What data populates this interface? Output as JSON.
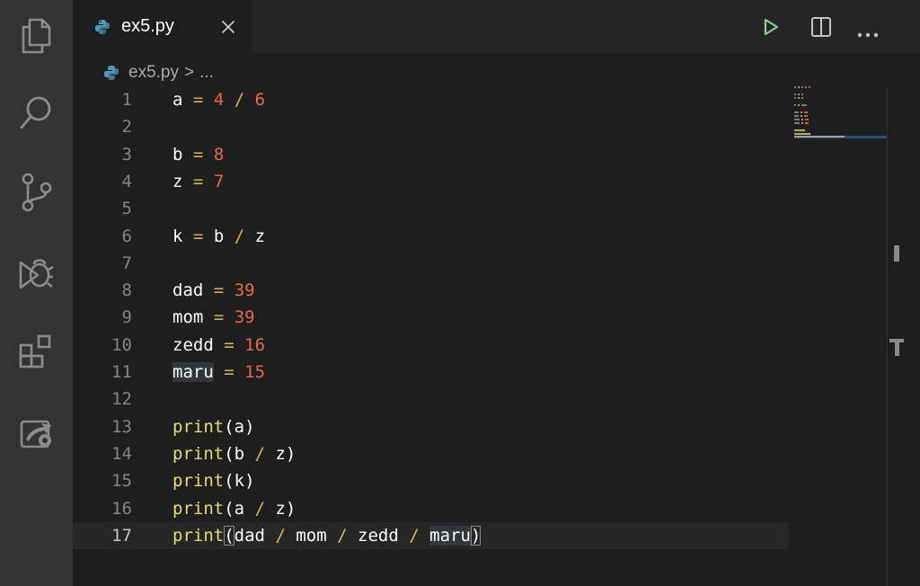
{
  "tab": {
    "title": "ex5.py"
  },
  "breadcrumb": {
    "file": "ex5.py",
    "separator": ">",
    "more": "..."
  },
  "activity_bar": {
    "items": [
      {
        "name": "explorer-icon"
      },
      {
        "name": "search-icon"
      },
      {
        "name": "source-control-icon"
      },
      {
        "name": "run-debug-icon"
      },
      {
        "name": "extensions-icon"
      },
      {
        "name": "remote-explorer-icon"
      }
    ]
  },
  "toolbar": {
    "run_icon": "play-icon",
    "split_icon": "split-editor-icon",
    "more_icon": "more-actions-icon"
  },
  "colors": {
    "variable": "#ffffff",
    "operator": "#d8b35b",
    "number": "#e06c4c",
    "function": "#e7db74",
    "line_number": "#858585",
    "run_icon": "#89d185",
    "python_icon": "#519aba"
  },
  "code": {
    "current_line": 17,
    "lines": [
      {
        "num": "1",
        "tokens": [
          [
            "var",
            "a"
          ],
          [
            "sp",
            " "
          ],
          [
            "op",
            "="
          ],
          [
            "sp",
            " "
          ],
          [
            "num",
            "4"
          ],
          [
            "sp",
            " "
          ],
          [
            "op",
            "/"
          ],
          [
            "sp",
            " "
          ],
          [
            "num",
            "6"
          ]
        ]
      },
      {
        "num": "2",
        "tokens": []
      },
      {
        "num": "3",
        "tokens": [
          [
            "var",
            "b"
          ],
          [
            "sp",
            " "
          ],
          [
            "op",
            "="
          ],
          [
            "sp",
            " "
          ],
          [
            "num",
            "8"
          ]
        ]
      },
      {
        "num": "4",
        "tokens": [
          [
            "var",
            "z"
          ],
          [
            "sp",
            " "
          ],
          [
            "op",
            "="
          ],
          [
            "sp",
            " "
          ],
          [
            "num",
            "7"
          ]
        ]
      },
      {
        "num": "5",
        "tokens": []
      },
      {
        "num": "6",
        "tokens": [
          [
            "var",
            "k"
          ],
          [
            "sp",
            " "
          ],
          [
            "op",
            "="
          ],
          [
            "sp",
            " "
          ],
          [
            "var",
            "b"
          ],
          [
            "sp",
            " "
          ],
          [
            "op",
            "/"
          ],
          [
            "sp",
            " "
          ],
          [
            "var",
            "z"
          ]
        ]
      },
      {
        "num": "7",
        "tokens": []
      },
      {
        "num": "8",
        "tokens": [
          [
            "var",
            "dad"
          ],
          [
            "sp",
            " "
          ],
          [
            "op",
            "="
          ],
          [
            "sp",
            " "
          ],
          [
            "num",
            "39"
          ]
        ]
      },
      {
        "num": "9",
        "tokens": [
          [
            "var",
            "mom"
          ],
          [
            "sp",
            " "
          ],
          [
            "op",
            "="
          ],
          [
            "sp",
            " "
          ],
          [
            "num",
            "39"
          ]
        ]
      },
      {
        "num": "10",
        "tokens": [
          [
            "var",
            "zedd"
          ],
          [
            "sp",
            " "
          ],
          [
            "op",
            "="
          ],
          [
            "sp",
            " "
          ],
          [
            "num",
            "16"
          ]
        ]
      },
      {
        "num": "11",
        "tokens": [
          [
            "hl",
            "maru"
          ],
          [
            "sp",
            " "
          ],
          [
            "op",
            "="
          ],
          [
            "sp",
            " "
          ],
          [
            "num",
            "15"
          ]
        ]
      },
      {
        "num": "12",
        "tokens": []
      },
      {
        "num": "13",
        "tokens": [
          [
            "fn",
            "print"
          ],
          [
            "paren",
            "("
          ],
          [
            "var",
            "a"
          ],
          [
            "paren",
            ")"
          ]
        ]
      },
      {
        "num": "14",
        "tokens": [
          [
            "fn",
            "print"
          ],
          [
            "paren",
            "("
          ],
          [
            "var",
            "b"
          ],
          [
            "sp",
            " "
          ],
          [
            "op",
            "/"
          ],
          [
            "sp",
            " "
          ],
          [
            "var",
            "z"
          ],
          [
            "paren",
            ")"
          ]
        ]
      },
      {
        "num": "15",
        "tokens": [
          [
            "fn",
            "print"
          ],
          [
            "paren",
            "("
          ],
          [
            "var",
            "k"
          ],
          [
            "paren",
            ")"
          ]
        ]
      },
      {
        "num": "16",
        "tokens": [
          [
            "fn",
            "print"
          ],
          [
            "paren",
            "("
          ],
          [
            "var",
            "a"
          ],
          [
            "sp",
            " "
          ],
          [
            "op",
            "/"
          ],
          [
            "sp",
            " "
          ],
          [
            "var",
            "z"
          ],
          [
            "paren",
            ")"
          ]
        ]
      },
      {
        "num": "17",
        "tokens": [
          [
            "fn",
            "print"
          ],
          [
            "bm",
            "("
          ],
          [
            "var",
            "dad"
          ],
          [
            "sp",
            " "
          ],
          [
            "op",
            "/"
          ],
          [
            "sp",
            " "
          ],
          [
            "var",
            "mom"
          ],
          [
            "sp",
            " "
          ],
          [
            "op",
            "/"
          ],
          [
            "sp",
            " "
          ],
          [
            "var",
            "zedd"
          ],
          [
            "sp",
            " "
          ],
          [
            "op",
            "/"
          ],
          [
            "sp",
            " "
          ],
          [
            "hl",
            "maru"
          ],
          [
            "bm",
            ")"
          ]
        ]
      }
    ]
  }
}
